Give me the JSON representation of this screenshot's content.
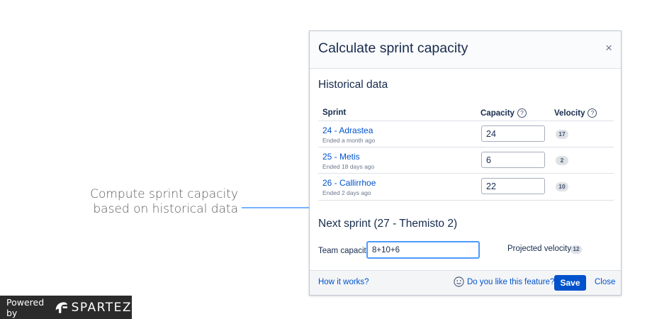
{
  "annotation": {
    "line1": "Compute sprint capacity",
    "line2": "based on historical data"
  },
  "powered_by": {
    "text": "Powered by",
    "brand": "SPARTEZ"
  },
  "dialog": {
    "title": "Calculate sprint capacity",
    "close_symbol": "×",
    "historical": {
      "title": "Historical data",
      "headers": {
        "sprint": "Sprint",
        "capacity": "Capacity",
        "velocity": "Velocity"
      },
      "rows": [
        {
          "name": "24 - Adrastea",
          "ended": "Ended a month ago",
          "capacity": "24",
          "velocity": "17"
        },
        {
          "name": "25 - Metis",
          "ended": "Ended 18 days ago",
          "capacity": "6",
          "velocity": "2"
        },
        {
          "name": "26 - Callirrhoe",
          "ended": "Ended 2 days ago",
          "capacity": "22",
          "velocity": "10"
        }
      ]
    },
    "next_sprint": {
      "title": "Next sprint (27 - Themisto 2)",
      "team_capacity_label": "Team capacity:",
      "team_capacity_value": "8+10+6",
      "projected_label": "Projected velocity:",
      "projected_value": "12"
    },
    "footer": {
      "how_it_works": "How it works?",
      "feedback": "Do you like this feature?",
      "save": "Save",
      "close": "Close"
    }
  },
  "colors": {
    "accent": "#0052cc",
    "focus_border": "#4c9aff",
    "badge_bg": "#dfe1e6",
    "callout_line": "#2684ff"
  },
  "icons": [
    "help-icon",
    "close-icon",
    "smile-icon",
    "spartez-logo-icon"
  ]
}
